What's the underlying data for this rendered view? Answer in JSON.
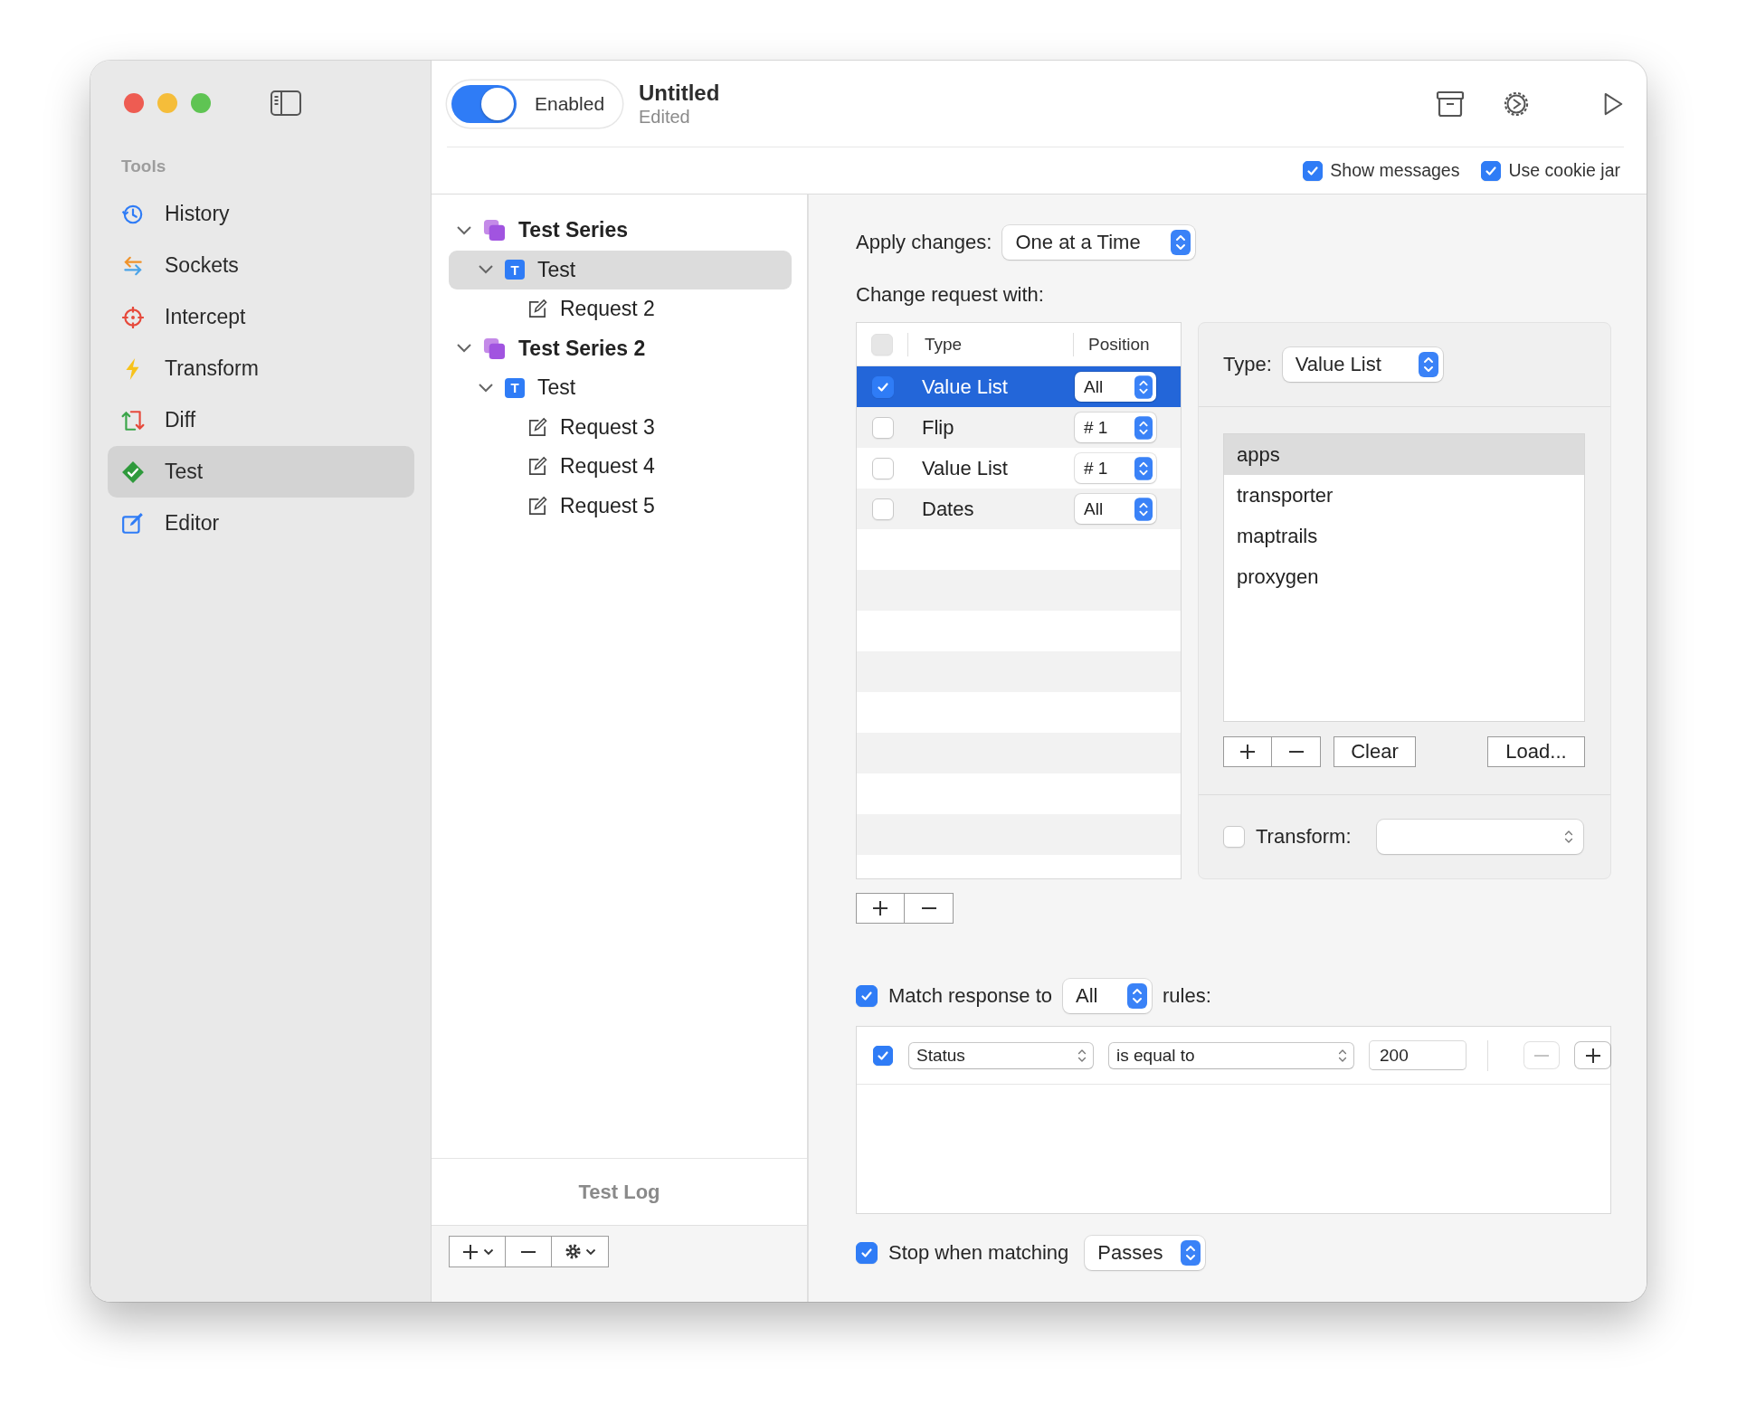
{
  "window": {
    "title": "Untitled",
    "subtitle": "Edited"
  },
  "toolbar": {
    "enabled_toggle": {
      "label": "Enabled",
      "on": true
    }
  },
  "options": [
    {
      "label": "Show messages",
      "checked": true
    },
    {
      "label": "Use cookie jar",
      "checked": true
    }
  ],
  "sidebar": {
    "section": "Tools",
    "items": [
      {
        "label": "History",
        "kind": "history",
        "selected": false
      },
      {
        "label": "Sockets",
        "kind": "sockets",
        "selected": false
      },
      {
        "label": "Intercept",
        "kind": "intercept",
        "selected": false
      },
      {
        "label": "Transform",
        "kind": "transform",
        "selected": false
      },
      {
        "label": "Diff",
        "kind": "diff",
        "selected": false
      },
      {
        "label": "Test",
        "kind": "test",
        "selected": true
      },
      {
        "label": "Editor",
        "kind": "editor",
        "selected": false
      }
    ]
  },
  "tree": {
    "items": [
      {
        "label": "Test Series",
        "kind": "series",
        "expanded": true,
        "selected": false,
        "children": [
          {
            "label": "Test",
            "kind": "test",
            "badge": "T",
            "expanded": true,
            "selected": true,
            "children": [
              {
                "label": "Request 2",
                "kind": "request",
                "selected": false
              }
            ]
          }
        ]
      },
      {
        "label": "Test Series 2",
        "kind": "series",
        "expanded": true,
        "selected": false,
        "children": [
          {
            "label": "Test",
            "kind": "test",
            "badge": "T",
            "expanded": true,
            "selected": false,
            "children": [
              {
                "label": "Request 3",
                "kind": "request",
                "selected": false
              },
              {
                "label": "Request 4",
                "kind": "request",
                "selected": false
              },
              {
                "label": "Request 5",
                "kind": "request",
                "selected": false
              }
            ]
          }
        ]
      }
    ]
  },
  "test_log": {
    "label": "Test Log"
  },
  "apply_changes": {
    "label": "Apply changes:",
    "value": "One at a Time"
  },
  "change_request": {
    "label": "Change request with:",
    "select_all": {
      "checked": false,
      "disabled": true
    },
    "columns": [
      "Type",
      "Position"
    ],
    "rows": [
      {
        "type": "Value List",
        "position": "All",
        "checked": true,
        "selected": true
      },
      {
        "type": "Flip",
        "position": "# 1",
        "checked": false,
        "selected": false
      },
      {
        "type": "Value List",
        "position": "# 1",
        "checked": false,
        "selected": false
      },
      {
        "type": "Dates",
        "position": "All",
        "checked": false,
        "selected": false
      }
    ]
  },
  "type_panel": {
    "label": "Type:",
    "value": "Value List",
    "values": [
      {
        "text": "apps",
        "selected": true
      },
      {
        "text": "transporter",
        "selected": false
      },
      {
        "text": "maptrails",
        "selected": false
      },
      {
        "text": "proxygen",
        "selected": false
      }
    ],
    "clear_button": "Clear",
    "load_button": "Load...",
    "transform": {
      "label": "Transform:",
      "checked": false
    }
  },
  "match_response": {
    "checked": true,
    "label": "Match response to",
    "value": "All",
    "suffix": "rules:",
    "rules": [
      {
        "checked": true,
        "field": "Status",
        "operator": "is equal to",
        "value": "200",
        "remove_disabled": true
      }
    ]
  },
  "stop_when": {
    "checked": true,
    "label": "Stop when matching",
    "value": "Passes"
  }
}
